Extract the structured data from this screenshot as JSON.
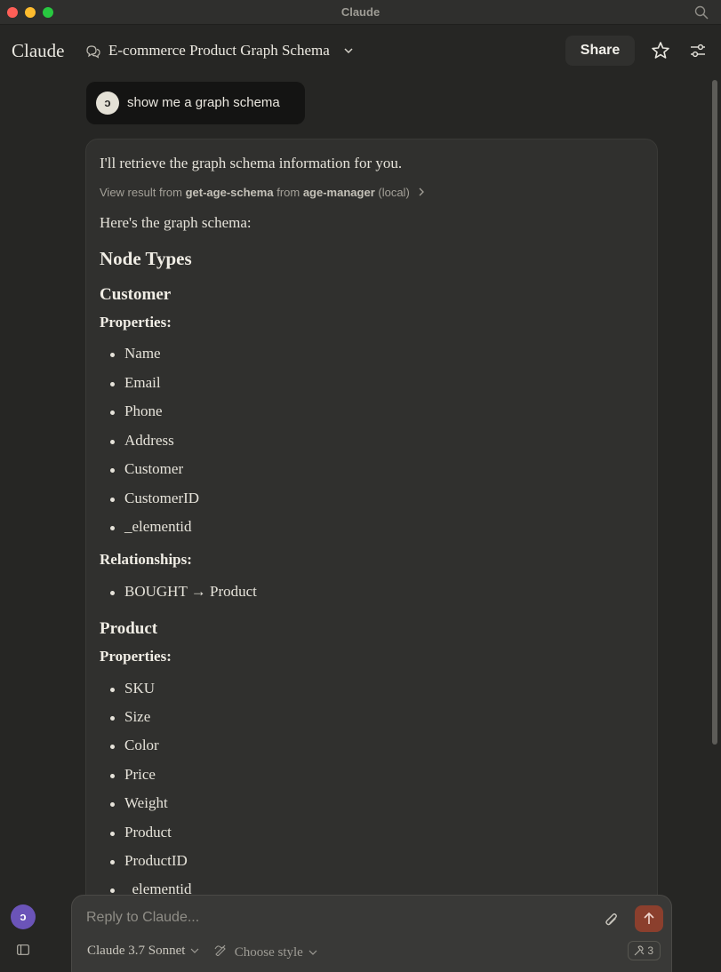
{
  "window": {
    "title": "Claude"
  },
  "header": {
    "logo": "Claude",
    "conversation_title": "E-commerce Product Graph Schema",
    "share_label": "Share"
  },
  "user_message": {
    "avatar_initial": "ↄ",
    "text": "show me a graph schema"
  },
  "assistant": {
    "intro": "I'll retrieve the graph schema information for you.",
    "tool_result": {
      "prefix": "View result from",
      "tool": "get-age-schema",
      "mid": "from",
      "server": "age-manager",
      "suffix": "(local)"
    },
    "lead": "Here's the graph schema:",
    "heading": "Node Types",
    "customer": {
      "title": "Customer",
      "properties_label": "Properties:",
      "properties": [
        "Name",
        "Email",
        "Phone",
        "Address",
        "Customer",
        "CustomerID",
        "_elementid"
      ],
      "relationships_label": "Relationships:",
      "relationships": [
        "BOUGHT → Product"
      ]
    },
    "product": {
      "title": "Product",
      "properties_label": "Properties:",
      "properties": [
        "SKU",
        "Size",
        "Color",
        "Price",
        "Weight",
        "Product",
        "ProductID",
        "_elementid"
      ]
    }
  },
  "composer": {
    "placeholder": "Reply to Claude...",
    "model": "Claude 3.7 Sonnet",
    "style": "Choose style",
    "tools_count": "3"
  },
  "sidebar": {
    "avatar_initial": "ↄ"
  },
  "colors": {
    "background": "#262624",
    "card": "#30302e",
    "send": "#8b3f2d",
    "avatar": "#6b54b8"
  }
}
